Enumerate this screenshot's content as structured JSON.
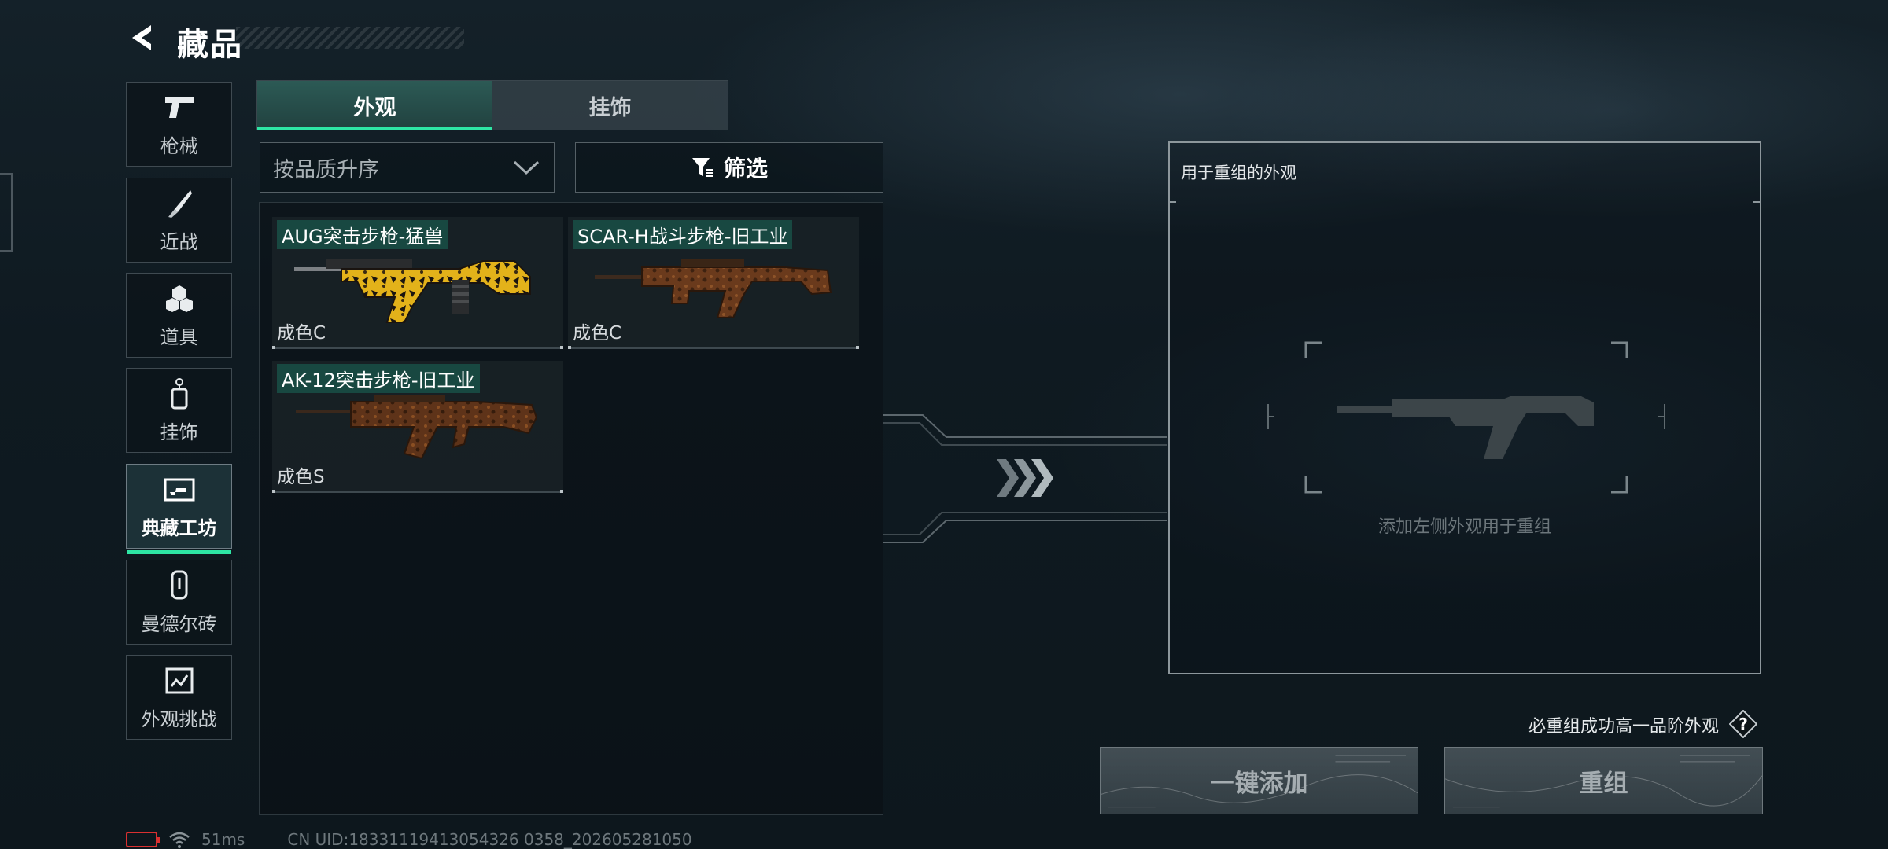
{
  "header": {
    "title": "藏品"
  },
  "nav": {
    "items": [
      {
        "label": "枪械",
        "icon": "pistol-icon"
      },
      {
        "label": "近战",
        "icon": "knife-icon"
      },
      {
        "label": "道具",
        "icon": "grenade-icon"
      },
      {
        "label": "挂饰",
        "icon": "charm-icon"
      },
      {
        "label": "典藏工坊",
        "icon": "workshop-icon",
        "active": true
      },
      {
        "label": "曼德尔砖",
        "icon": "brick-icon"
      },
      {
        "label": "外观挑战",
        "icon": "challenge-icon"
      }
    ]
  },
  "tabs": [
    {
      "label": "外观",
      "active": true
    },
    {
      "label": "挂饰",
      "active": false
    }
  ],
  "sort": {
    "selected": "按品质升序"
  },
  "filter": {
    "label": "筛选"
  },
  "skins": [
    {
      "name": "AUG突击步枪-猛兽",
      "grade": "成色C",
      "pattern": "yellow-camo"
    },
    {
      "name": "SCAR-H战斗步枪-旧工业",
      "grade": "成色C",
      "pattern": "rust"
    },
    {
      "name": "AK-12突击步枪-旧工业",
      "grade": "成色S",
      "pattern": "rust"
    }
  ],
  "reforge": {
    "title": "用于重组的外观",
    "hint": "添加左侧外观用于重组",
    "guarantee": "必重组成功高一品阶外观",
    "add_all_label": "一键添加",
    "reforge_label": "重组"
  },
  "status": {
    "ping": "51ms",
    "uid": "CN UID:18331119413054326 0358_202605281050"
  },
  "colors": {
    "accent": "#2ee6a5",
    "tab_active": "#2c5a55",
    "battery_low": "#d93030"
  }
}
